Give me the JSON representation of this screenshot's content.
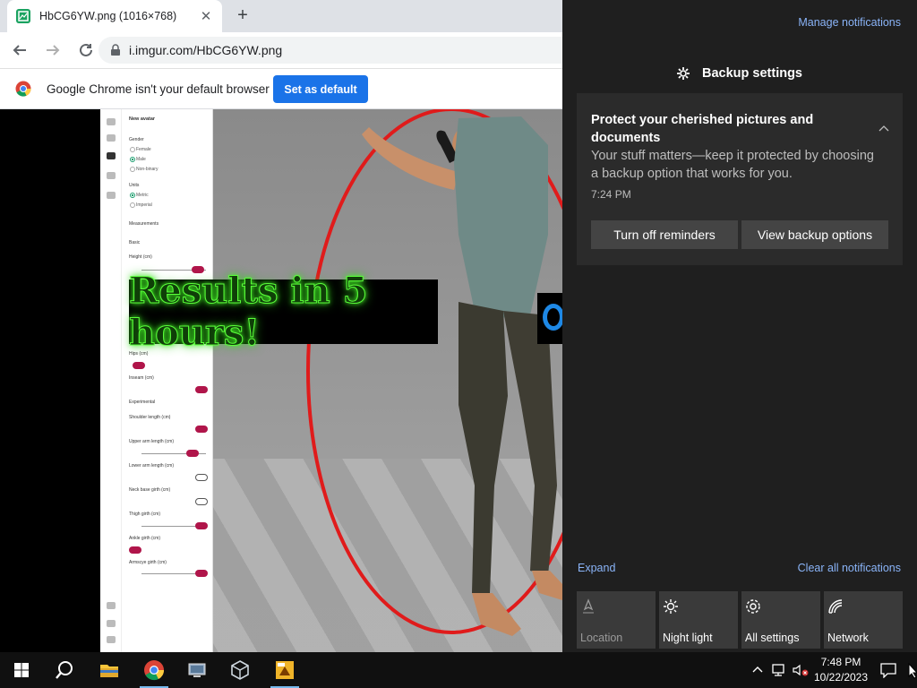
{
  "browser": {
    "tab_title": "HbCG6YW.png (1016×768)",
    "tab_close": "✕",
    "new_tab": "+",
    "url": "i.imgur.com/HbCG6YW.png",
    "infobar_text": "Google Chrome isn't your default browser",
    "set_default_label": "Set as default"
  },
  "page_image": {
    "panel": {
      "title": "New avatar",
      "gender_label": "Gender",
      "gender_options": [
        "Female",
        "Male",
        "Non-binary"
      ],
      "gender_selected": "Male",
      "units_label": "Units",
      "units_options": [
        "Metric",
        "Imperial"
      ],
      "units_selected": "Metric",
      "measurements_label": "Measurements",
      "basic_label": "Basic",
      "height_label": "Height (cm)",
      "hips_label": "Hips (cm)",
      "inseam_label": "Inseam (cm)",
      "experimental_label": "Experimental",
      "fields": [
        "Shoulder length (cm)",
        "Upper arm length (cm)",
        "Lower arm length (cm)",
        "Neck base girth (cm)",
        "Thigh girth (cm)",
        "Ankle girth (cm)",
        "Armscye girth (cm)"
      ]
    },
    "ad_text": "Results in 5 hours!"
  },
  "action_center": {
    "manage_notifications": "Manage notifications",
    "app_name": "Backup settings",
    "notification": {
      "title": "Protect your cherished pictures and documents",
      "body": "Your stuff matters—keep it protected by choosing a backup option that works for you.",
      "time": "7:24 PM",
      "buttons": [
        "Turn off reminders",
        "View backup options"
      ]
    },
    "expand": "Expand",
    "clear_all": "Clear all notifications",
    "quick_actions": [
      {
        "label": "Location",
        "icon": "location-icon",
        "enabled": false
      },
      {
        "label": "Night light",
        "icon": "night-light-icon",
        "enabled": true
      },
      {
        "label": "All settings",
        "icon": "gear-icon",
        "enabled": true
      },
      {
        "label": "Network",
        "icon": "network-icon",
        "enabled": true
      }
    ]
  },
  "taskbar": {
    "pinned": [
      "start-icon",
      "search-icon",
      "file-explorer-icon",
      "chrome-icon",
      "vm-icon",
      "virtualbox-icon",
      "app-icon"
    ],
    "clock_time": "7:48 PM",
    "clock_date": "10/22/2023"
  },
  "colors": {
    "accent_blue": "#1a73e8",
    "link_blue": "#8ab4f8",
    "action_center_bg": "#1f1f1f",
    "taskbar_bg": "#101010"
  }
}
